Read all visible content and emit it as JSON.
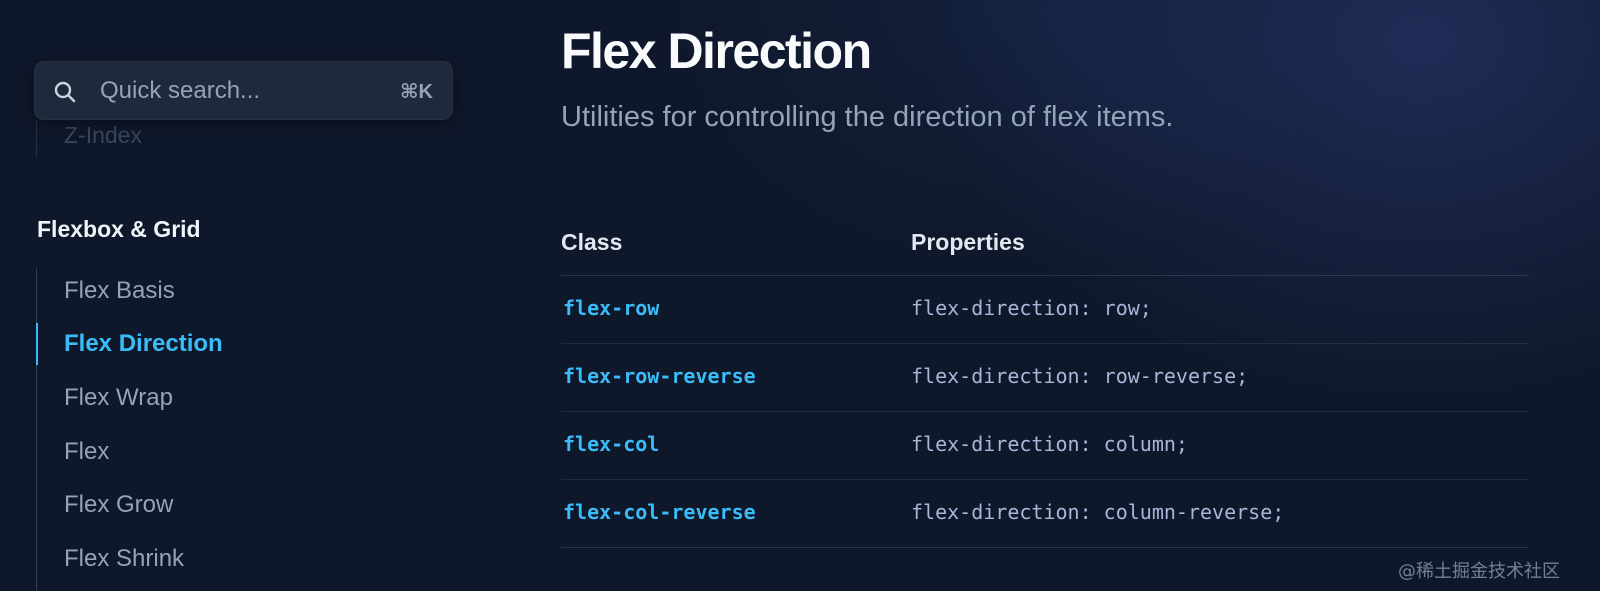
{
  "search": {
    "placeholder": "Quick search...",
    "shortcut": "⌘K"
  },
  "sidebar": {
    "faded_item": "Z-Index",
    "section_heading": "Flexbox & Grid",
    "items": [
      {
        "label": "Flex Basis",
        "active": false
      },
      {
        "label": "Flex Direction",
        "active": true
      },
      {
        "label": "Flex Wrap",
        "active": false
      },
      {
        "label": "Flex",
        "active": false
      },
      {
        "label": "Flex Grow",
        "active": false
      },
      {
        "label": "Flex Shrink",
        "active": false
      }
    ]
  },
  "main": {
    "title": "Flex Direction",
    "description": "Utilities for controlling the direction of flex items.",
    "table": {
      "headers": [
        "Class",
        "Properties"
      ],
      "rows": [
        {
          "class": "flex-row",
          "properties": "flex-direction: row;"
        },
        {
          "class": "flex-row-reverse",
          "properties": "flex-direction: row-reverse;"
        },
        {
          "class": "flex-col",
          "properties": "flex-direction: column;"
        },
        {
          "class": "flex-col-reverse",
          "properties": "flex-direction: column-reverse;"
        }
      ]
    }
  },
  "watermark": "@稀土掘金技术社区",
  "colors": {
    "background": "#0f172a",
    "accent": "#38bdf8",
    "muted_text": "#94a3b8",
    "search_bg": "#1e293b"
  }
}
